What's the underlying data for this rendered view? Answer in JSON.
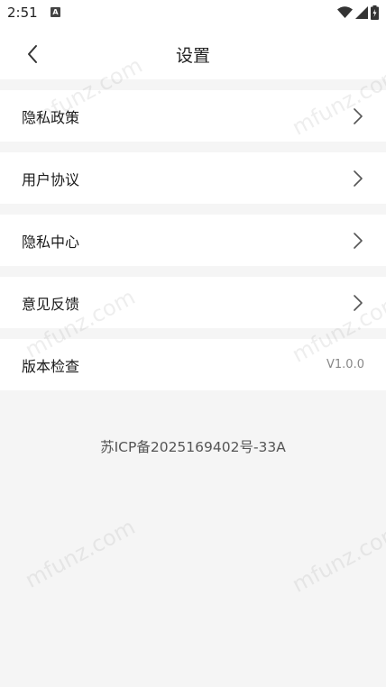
{
  "status_bar": {
    "time": "2:51",
    "notification_glyph": "A",
    "icons": [
      "wifi-icon",
      "signal-icon",
      "battery-icon"
    ]
  },
  "header": {
    "title": "设置",
    "back_icon": "chevron-left-icon"
  },
  "settings": {
    "items": [
      {
        "label": "隐私政策",
        "trailing": "chevron-right-icon"
      },
      {
        "label": "用户协议",
        "trailing": "chevron-right-icon"
      },
      {
        "label": "隐私中心",
        "trailing": "chevron-right-icon"
      },
      {
        "label": "意见反馈",
        "trailing": "chevron-right-icon"
      },
      {
        "label": "版本检查",
        "value": "V1.0.0"
      }
    ]
  },
  "footer": {
    "icp": "苏ICP备2025169402号-33A"
  },
  "watermark": "mfunz.com",
  "colors": {
    "background": "#f5f5f5",
    "surface": "#ffffff",
    "text": "#1a1a1a",
    "muted": "#888888"
  }
}
